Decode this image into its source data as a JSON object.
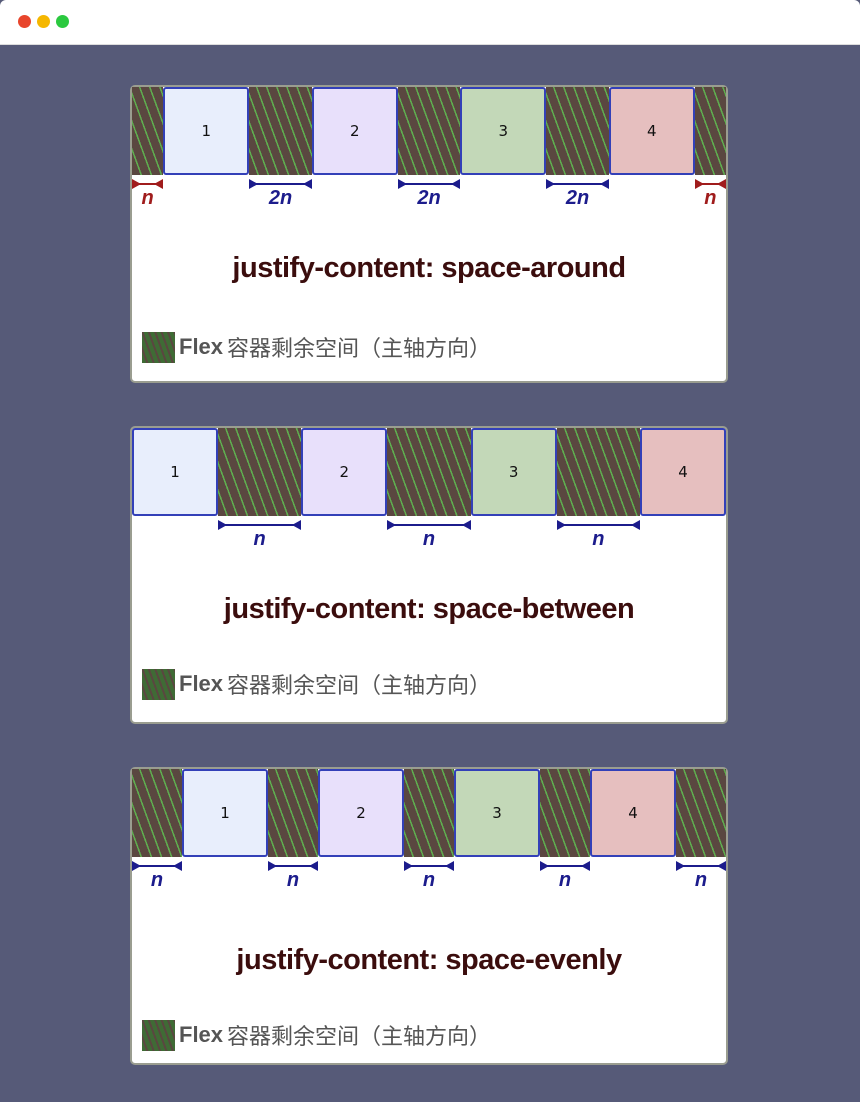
{
  "window": {
    "controls": [
      "close",
      "minimize",
      "maximize"
    ],
    "colors": {
      "close": "#e8452c",
      "minimize": "#f5b700",
      "maximize": "#2bc93f"
    }
  },
  "panels": [
    {
      "title": "justify-content: space-around",
      "boxes": [
        "1",
        "2",
        "3",
        "4"
      ],
      "gaps": [
        {
          "grow": 1,
          "label": "n",
          "color": "#a01c1c"
        },
        {
          "grow": 2,
          "label": "2n",
          "color": "#1c1c8c"
        },
        {
          "grow": 2,
          "label": "2n",
          "color": "#1c1c8c"
        },
        {
          "grow": 2,
          "label": "2n",
          "color": "#1c1c8c"
        },
        {
          "grow": 1,
          "label": "n",
          "color": "#a01c1c"
        }
      ]
    },
    {
      "title": "justify-content: space-between",
      "boxes": [
        "1",
        "2",
        "3",
        "4"
      ],
      "gaps": [
        {
          "grow": 0,
          "label": "",
          "color": ""
        },
        {
          "grow": 1,
          "label": "n",
          "color": "#1c1c8c"
        },
        {
          "grow": 1,
          "label": "n",
          "color": "#1c1c8c"
        },
        {
          "grow": 1,
          "label": "n",
          "color": "#1c1c8c"
        },
        {
          "grow": 0,
          "label": "",
          "color": ""
        }
      ]
    },
    {
      "title": "justify-content: space-evenly",
      "boxes": [
        "1",
        "2",
        "3",
        "4"
      ],
      "gaps": [
        {
          "grow": 1,
          "label": "n",
          "color": "#1c1c8c"
        },
        {
          "grow": 1,
          "label": "n",
          "color": "#1c1c8c"
        },
        {
          "grow": 1,
          "label": "n",
          "color": "#1c1c8c"
        },
        {
          "grow": 1,
          "label": "n",
          "color": "#1c1c8c"
        },
        {
          "grow": 1,
          "label": "n",
          "color": "#1c1c8c"
        }
      ]
    }
  ],
  "box_colors": [
    "#e8eefc",
    "#e8e0fb",
    "#c3d8b8",
    "#e6bfbf"
  ],
  "legend": {
    "flex": "Flex",
    "text": "容器剩余空间（主轴方向）"
  }
}
